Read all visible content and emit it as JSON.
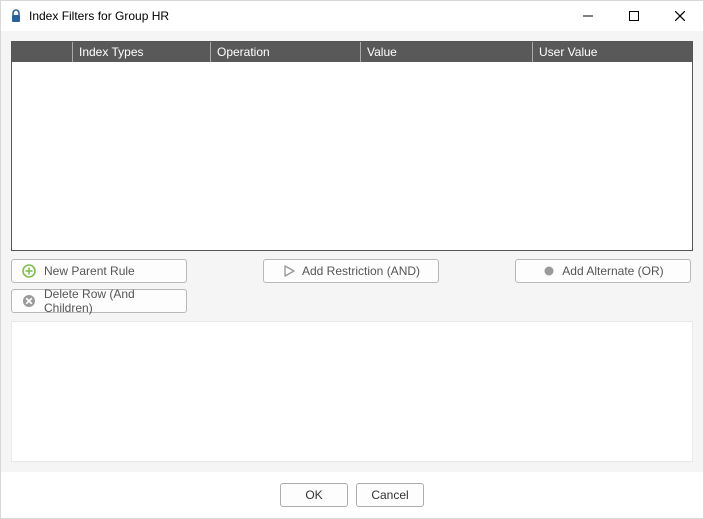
{
  "title": "Index Filters for Group HR",
  "columns": {
    "blank": "",
    "index_types": "Index Types",
    "operation": "Operation",
    "value": "Value",
    "user_value": "User Value"
  },
  "buttons": {
    "new_parent": "New Parent Rule",
    "add_restriction": "Add Restriction (AND)",
    "add_alternate": "Add Alternate (OR)",
    "delete_row": "Delete Row (And Children)"
  },
  "footer": {
    "ok": "OK",
    "cancel": "Cancel"
  }
}
